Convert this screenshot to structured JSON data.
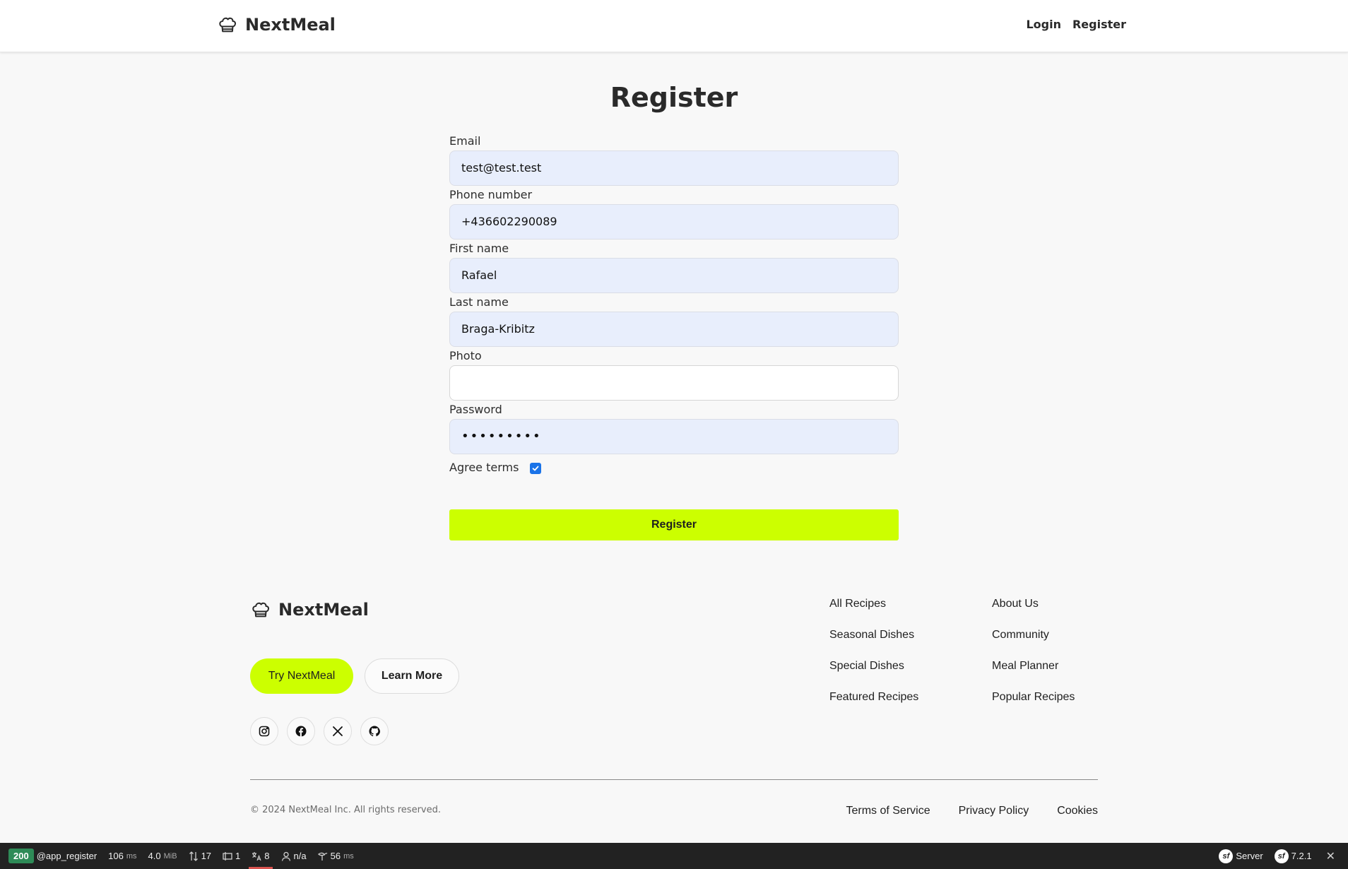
{
  "header": {
    "brand": "NextMeal",
    "nav": {
      "login": "Login",
      "register": "Register"
    }
  },
  "form": {
    "title": "Register",
    "email": {
      "label": "Email",
      "value": "test@test.test"
    },
    "phone": {
      "label": "Phone number",
      "value": "+436602290089"
    },
    "first_name": {
      "label": "First name",
      "value": "Rafael"
    },
    "last_name": {
      "label": "Last name",
      "value": "Braga-Kribitz"
    },
    "photo": {
      "label": "Photo",
      "value": ""
    },
    "password": {
      "label": "Password",
      "value": "•••••••••"
    },
    "agree": {
      "label": "Agree terms",
      "checked": true
    },
    "submit_label": "Register"
  },
  "footer": {
    "brand": "NextMeal",
    "cta_primary": "Try NextMeal",
    "cta_secondary": "Learn More",
    "socials": [
      "instagram-icon",
      "facebook-icon",
      "x-icon",
      "github-icon"
    ],
    "links_col1": [
      "All Recipes",
      "Seasonal Dishes",
      "Special Dishes",
      "Featured Recipes"
    ],
    "links_col2": [
      "About Us",
      "Community",
      "Meal Planner",
      "Popular Recipes"
    ],
    "copyright": "© 2024 NextMeal Inc. All rights reserved.",
    "legal": [
      "Terms of Service",
      "Privacy Policy",
      "Cookies"
    ]
  },
  "debug_toolbar": {
    "status": "200",
    "route": "@app_register",
    "time_value": "106",
    "time_unit": "ms",
    "memory_value": "4.0",
    "memory_unit": "MiB",
    "requests": "17",
    "forms": "1",
    "translations": "8",
    "user": "n/a",
    "render_value": "56",
    "render_unit": "ms",
    "server_label": "Server",
    "version": "7.2.1"
  },
  "colors": {
    "accent": "#ccff00",
    "input_bg": "#e8eefc",
    "status_ok": "#2e8b57"
  }
}
